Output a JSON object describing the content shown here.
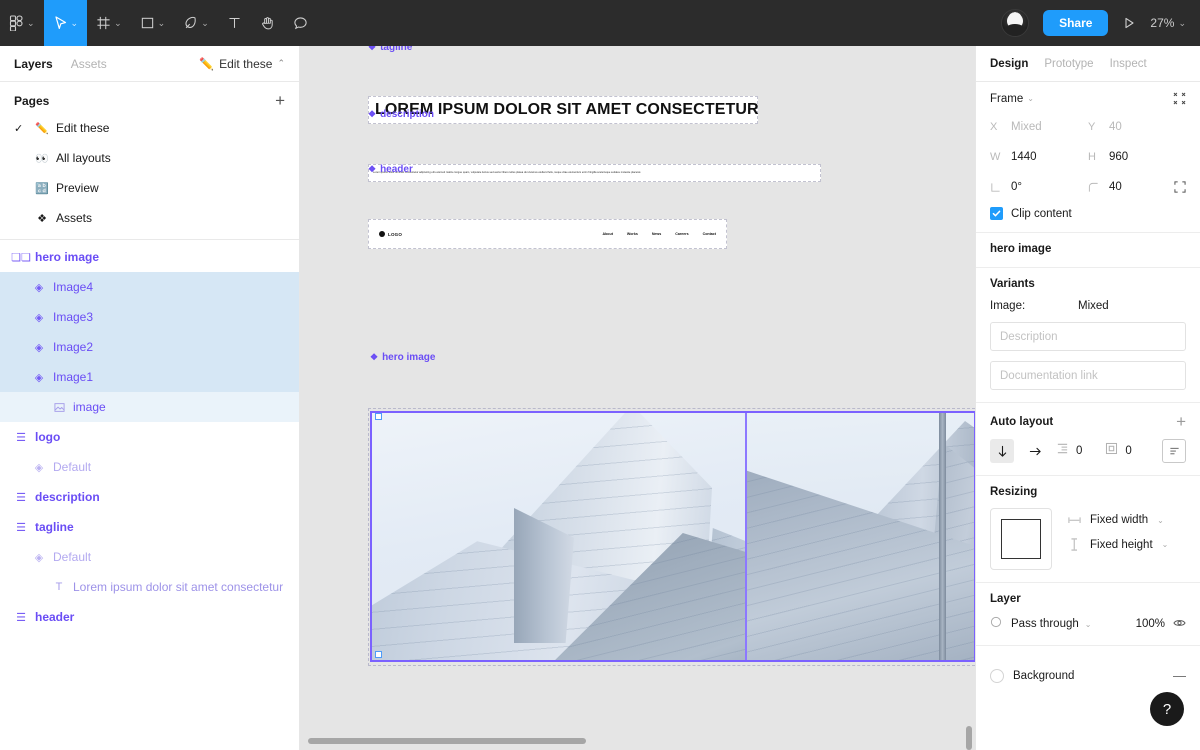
{
  "toolbar": {
    "tools": [
      {
        "name": "figma-menu-icon",
        "label": "Main menu",
        "caret": true
      },
      {
        "name": "move-tool-icon",
        "label": "Move",
        "caret": true
      },
      {
        "name": "frame-tool-icon",
        "label": "Frame",
        "caret": true
      },
      {
        "name": "shape-tool-icon",
        "label": "Rectangle",
        "caret": true
      },
      {
        "name": "pen-tool-icon",
        "label": "Pen",
        "caret": true
      },
      {
        "name": "text-tool-icon",
        "label": "Text",
        "caret": false
      },
      {
        "name": "hand-tool-icon",
        "label": "Hand",
        "caret": false
      },
      {
        "name": "comment-tool-icon",
        "label": "Comment",
        "caret": false
      }
    ],
    "share_label": "Share",
    "zoom_level": "27%",
    "present_label": "Present"
  },
  "left_panel": {
    "tabs": [
      {
        "label": "Layers",
        "active": true
      },
      {
        "label": "Assets",
        "active": false
      }
    ],
    "file_name": "Edit these",
    "pages_title": "Pages",
    "pages": [
      {
        "label": "Edit these",
        "icon": "pencil-emoji",
        "checked": true
      },
      {
        "label": "All layouts",
        "icon": "eyes-emoji",
        "checked": false
      },
      {
        "label": "Preview",
        "icon": "question-box-emoji",
        "checked": false
      },
      {
        "label": "Assets",
        "icon": "diamond-emoji",
        "checked": false
      }
    ],
    "layers": [
      {
        "label": "hero image",
        "icon": "component-set-icon",
        "indent": 0,
        "bold": true,
        "state": "normal"
      },
      {
        "label": "Image4",
        "icon": "component-icon",
        "indent": 1,
        "bold": false,
        "state": "selected"
      },
      {
        "label": "Image3",
        "icon": "component-icon",
        "indent": 1,
        "bold": false,
        "state": "selected"
      },
      {
        "label": "Image2",
        "icon": "component-icon",
        "indent": 1,
        "bold": false,
        "state": "selected"
      },
      {
        "label": "Image1",
        "icon": "component-icon",
        "indent": 1,
        "bold": false,
        "state": "selected"
      },
      {
        "label": "image",
        "icon": "image-icon",
        "indent": 2,
        "bold": false,
        "state": "selected-light"
      },
      {
        "label": "logo",
        "icon": "component-set-icon",
        "indent": 0,
        "bold": true,
        "state": "normal"
      },
      {
        "label": "Default",
        "icon": "component-icon",
        "indent": 1,
        "bold": false,
        "state": "muted"
      },
      {
        "label": "description",
        "icon": "component-set-icon",
        "indent": 0,
        "bold": true,
        "state": "normal"
      },
      {
        "label": "tagline",
        "icon": "component-set-icon",
        "indent": 0,
        "bold": true,
        "state": "normal"
      },
      {
        "label": "Default",
        "icon": "component-icon",
        "indent": 1,
        "bold": false,
        "state": "muted"
      },
      {
        "label": "Lorem ipsum dolor sit amet consectetur",
        "icon": "text-layer-icon",
        "indent": 2,
        "bold": false,
        "state": "muted2"
      },
      {
        "label": "header",
        "icon": "component-set-icon",
        "indent": 0,
        "bold": true,
        "state": "normal"
      }
    ]
  },
  "canvas": {
    "node_labels": {
      "tagline": "tagline",
      "description": "description",
      "header": "header",
      "hero_image": "hero image"
    },
    "tagline_text": "LOREM IPSUM DOLOR SIT AMET CONSECTETUR",
    "description_text": "Lorem ipsum dolor sit amet consectetur adipiscing elit euismod mattis congue quam, vulputate luctus sed auctor libero tellus platea dui vivamus eleifend felis, neque vitae elementum enim fringilla scelerisque sodales molestie placerat.",
    "header": {
      "logo_text": "LOGO",
      "nav": [
        "About",
        "Works",
        "News",
        "Careers",
        "Contact"
      ]
    }
  },
  "right_panel": {
    "tabs": [
      {
        "label": "Design",
        "active": true
      },
      {
        "label": "Prototype",
        "active": false
      },
      {
        "label": "Inspect",
        "active": false
      }
    ],
    "frame": {
      "title": "Frame",
      "x_key": "X",
      "x_value": "Mixed",
      "y_key": "Y",
      "y_value": "40",
      "w_key": "W",
      "w_value": "1440",
      "h_key": "H",
      "h_value": "960",
      "rotation_value": "0°",
      "corner_value": "40",
      "clip_content_label": "Clip content",
      "clip_content_checked": true
    },
    "component_name": "hero image",
    "variants": {
      "title": "Variants",
      "property_key": "Image:",
      "property_value": "Mixed",
      "description_placeholder": "Description",
      "documentation_placeholder": "Documentation link"
    },
    "auto_layout": {
      "title": "Auto layout",
      "direction": "vertical",
      "spacing_value": "0",
      "padding_value": "0"
    },
    "resizing": {
      "title": "Resizing",
      "width_mode": "Fixed width",
      "height_mode": "Fixed height"
    },
    "layer": {
      "title": "Layer",
      "blend_mode": "Pass through",
      "opacity": "100%"
    },
    "background": {
      "label": "Background",
      "color": "#FFFFFF"
    }
  },
  "help": {
    "label": "?"
  },
  "colors": {
    "accent_blue": "#1f9cfb",
    "component_purple": "#6a4df5",
    "selection_blue": "#d6e7f5",
    "toolbar_bg": "#2c2c2c",
    "canvas_bg": "#e5e5e5"
  }
}
